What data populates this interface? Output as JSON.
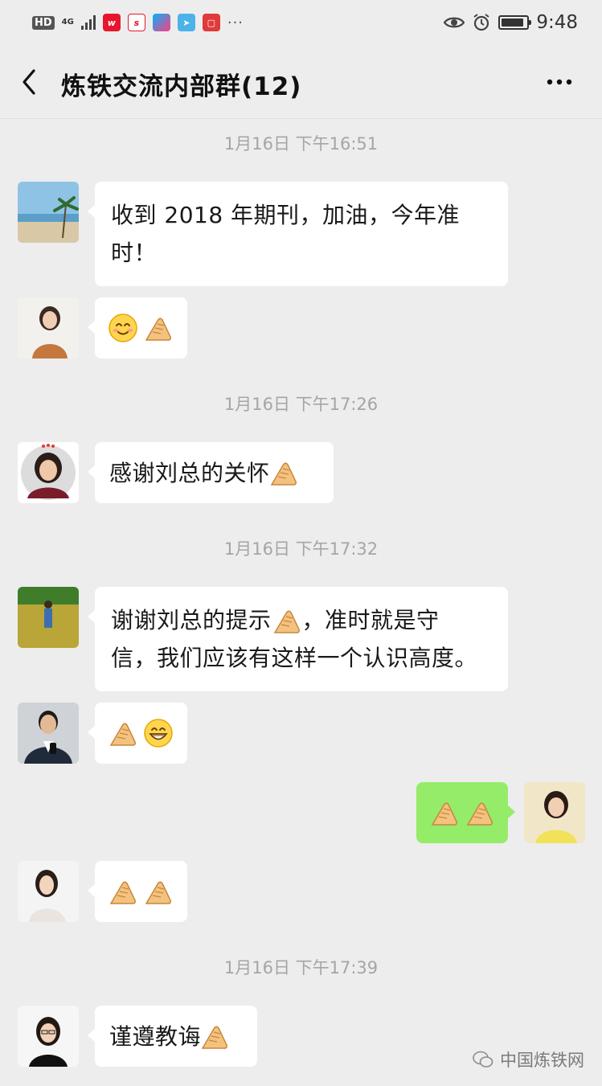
{
  "status_bar": {
    "hd": "HD",
    "network": "4G",
    "app_icons": [
      "sina-weibo-icon",
      "youku-icon",
      "tencent-icon",
      "news-icon"
    ],
    "more": "···",
    "time": "9:48"
  },
  "nav": {
    "title": "炼铁交流内部群(12)"
  },
  "timestamps": [
    "1月16日 下午16:51",
    "1月16日 下午17:26",
    "1月16日 下午17:32",
    "1月16日 下午17:39"
  ],
  "messages": [
    {
      "side": "left",
      "avatar": "beach-avatar",
      "lines": [
        "收到 2018 年期刊，加油，今年准",
        "时！"
      ]
    },
    {
      "side": "left",
      "avatar": "woman-avatar-1",
      "emojis": [
        "smile-emoji",
        "pointing-hand-emoji"
      ]
    },
    {
      "side": "left",
      "avatar": "woman-avatar-2",
      "text": "感谢刘总的关怀",
      "emojis": [
        "pointing-hand-emoji"
      ]
    },
    {
      "side": "left",
      "avatar": "field-avatar",
      "lines": [
        "谢谢刘总的提示",
        "，准时就是守",
        "信，我们应该有这样一个认识高度。"
      ]
    },
    {
      "side": "left",
      "avatar": "man-avatar",
      "emojis": [
        "pointing-hand-emoji",
        "grin-emoji"
      ]
    },
    {
      "side": "right",
      "avatar": "self-avatar",
      "emojis": [
        "pointing-hand-emoji",
        "pointing-hand-emoji"
      ]
    },
    {
      "side": "left",
      "avatar": "woman-avatar-3",
      "emojis": [
        "pointing-hand-emoji",
        "pointing-hand-emoji"
      ]
    },
    {
      "side": "left",
      "avatar": "woman-avatar-4",
      "text": "谨遵教诲",
      "emojis": [
        "pointing-hand-emoji"
      ]
    }
  ],
  "watermark": "中国炼铁网",
  "colors": {
    "background": "#ededed",
    "bubble_left": "#ffffff",
    "bubble_right": "#95ec69",
    "timestamp": "#a5a5a5"
  }
}
